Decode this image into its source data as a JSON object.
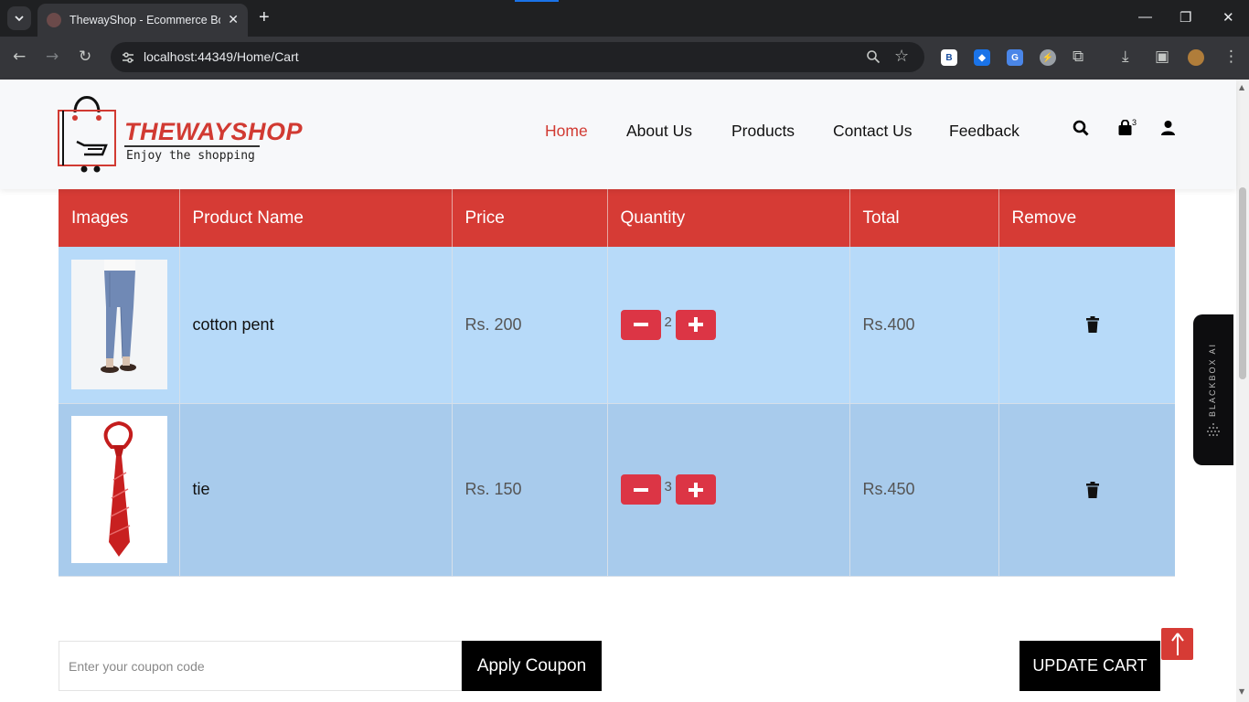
{
  "browser": {
    "tab_title": "ThewayShop - Ecommerce Book",
    "url": "localhost:44349/Home/Cart",
    "tab_close": "✕",
    "new_tab": "+"
  },
  "header": {
    "brand": "THEWAYSHOP",
    "tagline": "Enjoy the shopping",
    "menu": [
      "Home",
      "About Us",
      "Products",
      "Contact Us",
      "Feedback"
    ],
    "active_menu": "Home",
    "cart_count": "3"
  },
  "cart": {
    "columns": [
      "Images",
      "Product Name",
      "Price",
      "Quantity",
      "Total",
      "Remove"
    ],
    "rows": [
      {
        "name": "cotton pent",
        "price": "Rs. 200",
        "qty": "2",
        "total": "Rs.400"
      },
      {
        "name": "tie",
        "price": "Rs. 150",
        "qty": "3",
        "total": "Rs.450"
      }
    ]
  },
  "coupon": {
    "placeholder": "Enter your coupon code",
    "apply_label": "Apply Coupon"
  },
  "update_label": "UPDATE CART",
  "sidebar_widget": {
    "label": "BLACKBOX AI"
  },
  "colors": {
    "accent": "#d63b35",
    "row1": "#b7daf9",
    "row2": "#a8cbec",
    "button": "#dc3545"
  }
}
